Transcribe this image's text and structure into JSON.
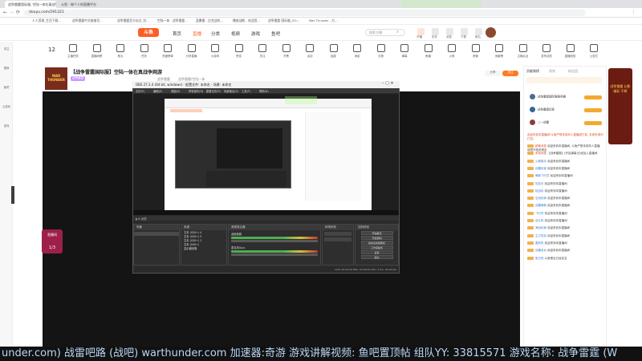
{
  "browser": {
    "tabs": [
      {
        "label": "战争雷霆国际服, 空陆一体在真战争..."
      },
      {
        "label": "斗鱼 - 每个人的直播平台"
      }
    ],
    "url": "douyu.com/291321",
    "bookmarks": [
      "人人资源_生活下载...",
      "战争雷霆中文维基百...",
      "战争雷霆官方站点_坦...",
      "空陆一体 - 战争雷霆...",
      "蓝叠雷 - 比克战机...",
      "播放战舰 - 欢迎您...",
      "战争雷霆 国际服_GO...",
      "War Thunder - 方..."
    ]
  },
  "site": {
    "logo": "斗鱼",
    "nav": [
      {
        "label": "首页",
        "active": false
      },
      {
        "label": "直播",
        "active": true
      },
      {
        "label": "分类",
        "active": false
      },
      {
        "label": "视频",
        "active": false
      },
      {
        "label": "游戏",
        "active": false
      },
      {
        "label": "鱼吧",
        "active": false
      }
    ],
    "search_placeholder": "搜索主播",
    "header_icons": [
      "开播",
      "历史",
      "消息",
      "下载",
      "鱼丸"
    ],
    "accent": "#ff5d23"
  },
  "categories": [
    "主播任务",
    "直播间榜",
    "鱼丸",
    "任务",
    "热度榜单",
    "分享直播",
    "小游戏",
    "赞赏",
    "关注",
    "开黑",
    "活动",
    "抽奖",
    "消息",
    "礼物",
    "弹幕",
    "鱼塘",
    "火箭",
    "房管",
    "贡献榜",
    "主播认证",
    "发布动态",
    "直播回放",
    "公告栏"
  ],
  "left_sidebar": [
    "关注",
    "推荐",
    "鱼吧",
    "云游戏",
    "游戏"
  ],
  "room": {
    "title": "【战争雷霆国际服】空陆一体在真战争网游",
    "tag": "战争雷霆",
    "meta": [
      "战争雷霆",
      "战争雷霆/空陆一体",
      "直播间号"
    ],
    "follow_label": "关注",
    "share_label": "分享"
  },
  "obs": {
    "title": "OBS 27.2.4 (64 bit, windows) - 配置文件: 未命名 - 场景: 未命名",
    "menu": [
      "文件(F)",
      "编辑(E)",
      "视图(V)",
      "停靠部件(D)",
      "配置文件(P)",
      "场景集合(S)",
      "工具(T)",
      "帮助(H)"
    ],
    "panels": {
      "scenes": "场景",
      "sources": "来源",
      "mixer": "音频混合器",
      "transitions": "转场特效",
      "controls": "控制按钮"
    },
    "sources": [
      "文本 (GDI+) 4",
      "文本 (GDI+) 3",
      "文本 (GDI+) 2",
      "文本 (GDI+)",
      "显示器采集"
    ],
    "mixer_tracks": [
      "桌面音频",
      "麦克风/Aux"
    ],
    "controls": [
      "开始推流",
      "开始录制",
      "启动虚拟摄像机",
      "工作室模式",
      "设置",
      "退出"
    ],
    "status": "LIVE: 00:00:00  REC: 00:00:00  CPU: 3.2%, 60.00 fps"
  },
  "stream_overlay": {
    "watermark": "under.com)    战雷吧路  (战吧)    warthunder.com    加速器:奇游    游戏讲解视频: 鱼吧置顶帖  组队YY: 33815571  游戏名称: 战争雷霆 (W"
  },
  "right_panel": {
    "tabs": [
      "贡献周榜",
      "贵宾",
      "粉丝团"
    ],
    "top_rank": [
      {
        "name": "战争雷霆国际服服务器"
      },
      {
        "name": "战争雷霆玩家"
      },
      {
        "name": "二一战雷"
      }
    ],
    "system_msg": "欢迎来到本直播间!斗鱼严禁未成年人直播或打赏, 未成年请勿打赏。",
    "chat": [
      {
        "name": "超管消息",
        "text": "欢迎来到本直播间, 斗鱼严禁未成年人直播, 请遵守相关规定"
      },
      {
        "name": "系统消息",
        "text": "【战争雷霆】(开启弹幕)已经加入直播间"
      },
      {
        "name": "火箭推手",
        "text": "欢迎来到本直播间"
      },
      {
        "name": "战雷玩家",
        "text": "欢迎来到本直播间"
      },
      {
        "name": "萌新飞行员",
        "text": "欢迎来到本直播间"
      },
      {
        "name": "坦克手",
        "text": "欢迎来到本直播间"
      },
      {
        "name": "陆战队",
        "text": "欢迎来到本直播间"
      },
      {
        "name": "空战玩家",
        "text": "欢迎来到本直播间"
      },
      {
        "name": "战雷萌新",
        "text": "欢迎来到本直播间"
      },
      {
        "name": "飞行员",
        "text": "欢迎来到本直播间"
      },
      {
        "name": "战斗机",
        "text": "欢迎来到本直播间"
      },
      {
        "name": "海战玩家",
        "text": "欢迎来到本直播间"
      },
      {
        "name": "主力坦克",
        "text": "欢迎来到本直播间"
      },
      {
        "name": "轰炸机",
        "text": "欢迎来到本直播间"
      },
      {
        "name": "战雷老兵",
        "text": "欢迎来到本直播间"
      },
      {
        "name": "夏日风",
        "text": "斗鱼是否已经实名"
      }
    ]
  },
  "promo": {
    "text": "战争雷霆 幻影 精彩 不断"
  },
  "side_popup": {
    "label": "直播间",
    "count": "1/3"
  }
}
